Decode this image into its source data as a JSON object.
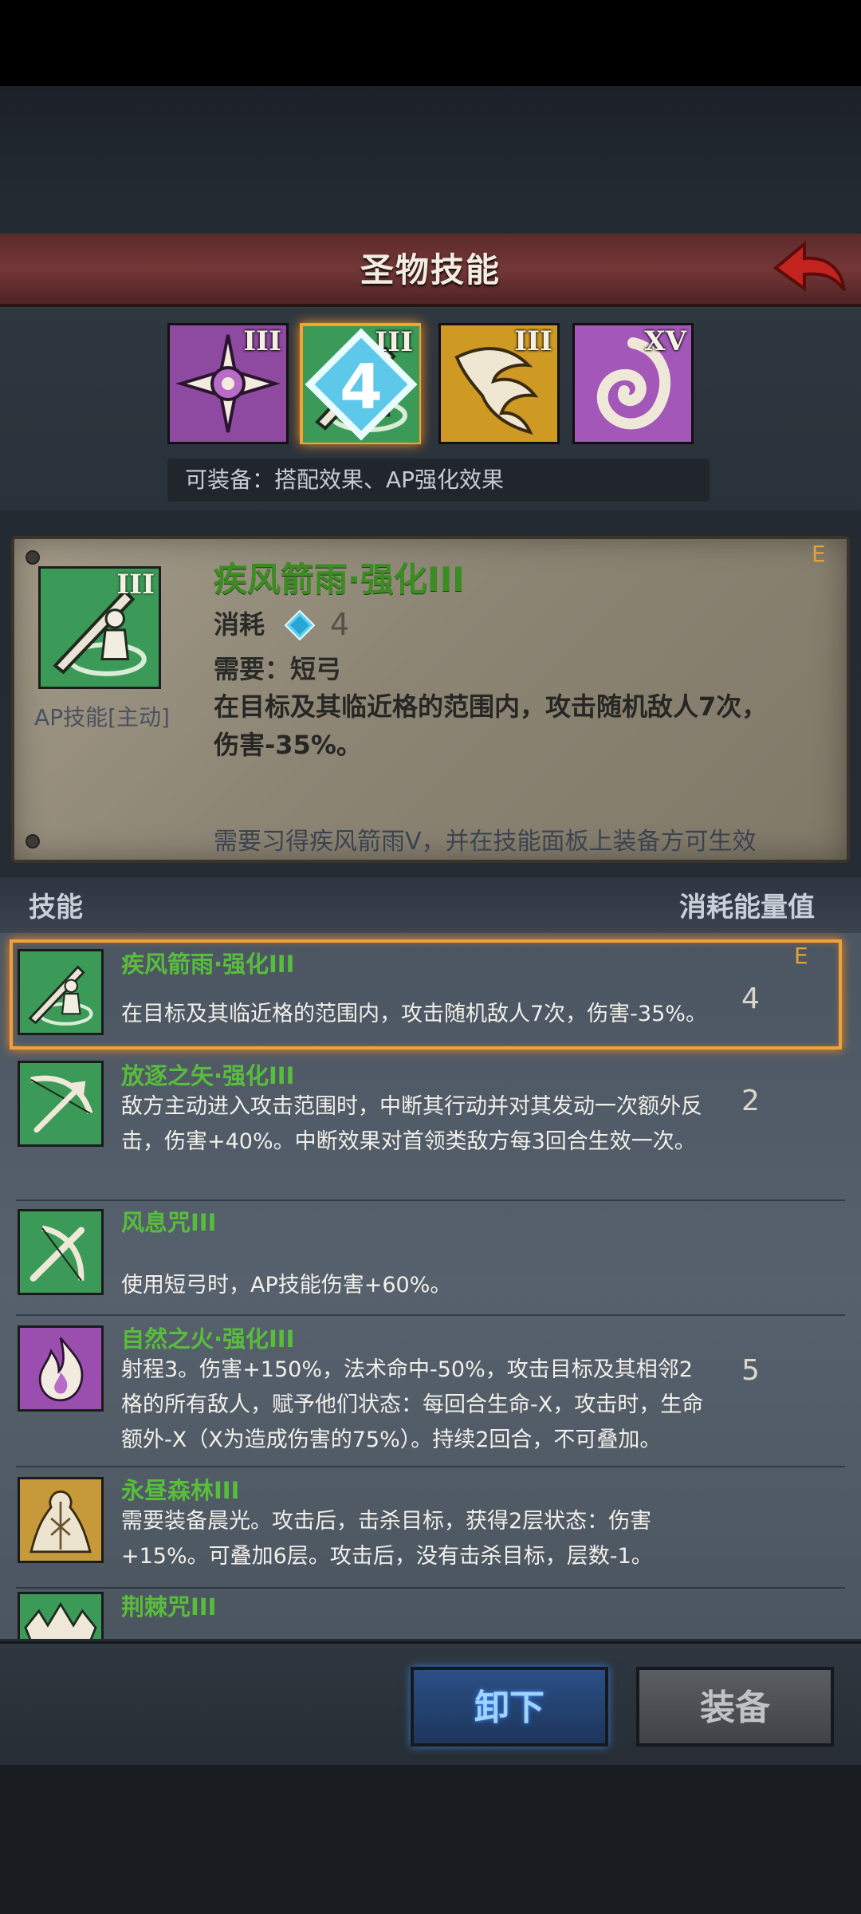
{
  "header": {
    "title": "圣物技能"
  },
  "relics": [
    {
      "level": "III",
      "color": "#8a3f9a",
      "icon": "cross-compass-icon"
    },
    {
      "level": "III",
      "color": "#2f8a4e",
      "icon": "sword-archer-icon",
      "badge": "4",
      "selected": true
    },
    {
      "level": "III",
      "color": "#c8931f",
      "icon": "phoenix-icon"
    },
    {
      "level": "XV",
      "color": "#9a4fae",
      "icon": "swirl-emblem-icon"
    }
  ],
  "equip_hint": "可装备：搭配效果、AP强化效果",
  "detail": {
    "level": "III",
    "type_label": "AP技能[主动]",
    "name": "疾风箭雨·强化III",
    "grade": "E",
    "cost_label": "消耗",
    "cost_value": "4",
    "requirement": "需要：短弓",
    "description": "在目标及其临近格的范围内，攻击随机敌人7次，伤害-35%。",
    "note": "需要习得疾风箭雨V，并在技能面板上装备方可生效"
  },
  "list_header": {
    "skill": "技能",
    "cost": "消耗能量值"
  },
  "skills": [
    {
      "name": "疾风箭雨·强化III",
      "desc": "在目标及其临近格的范围内，攻击随机敌人7次，伤害-35%。",
      "cost": "4",
      "grade": "E",
      "icon": "sword-archer-icon"
    },
    {
      "name": "放逐之矢·强化III",
      "desc": "敌方主动进入攻击范围时，中断其行动并对其发动一次额外反击，伤害+40%。中断效果对首领类敌方每3回合生效一次。",
      "cost": "2",
      "icon": "bow-arrow-icon"
    },
    {
      "name": "风息咒III",
      "desc": "使用短弓时，AP技能伤害+60%。",
      "cost": "",
      "icon": "crossed-bow-icon"
    },
    {
      "name": "自然之火·强化III",
      "desc": "射程3。伤害+150%，法术命中-50%，攻击目标及其相邻2格的所有敌人，赋予他们状态：每回合生命-X，攻击时，生命额外-X（X为造成伤害的75%）。持续2回合，不可叠加。",
      "cost": "5",
      "icon": "flame-icon"
    },
    {
      "name": "永昼森林III",
      "desc": "需要装备晨光。攻击后，击杀目标，获得2层状态：伤害+15%。可叠加6层。攻击后，没有击杀目标，层数-1。",
      "cost": "",
      "icon": "tree-icon"
    },
    {
      "name": "荆棘咒III",
      "desc": "",
      "cost": "",
      "icon": "thorn-icon"
    }
  ],
  "buttons": {
    "unequip": "卸下",
    "equip": "装备"
  }
}
